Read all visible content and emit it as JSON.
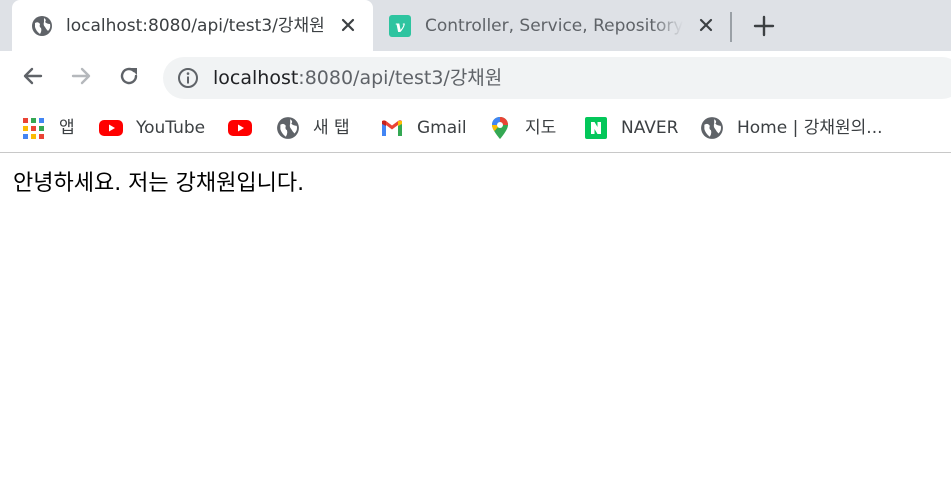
{
  "tabs": [
    {
      "title": "localhost:8080/api/test3/강채원",
      "active": true,
      "favicon": "globe-icon"
    },
    {
      "title": "Controller, Service, Repository 가",
      "active": false,
      "favicon": "vue-icon"
    }
  ],
  "toolbar": {
    "back": "back-arrow-icon",
    "forward": "forward-arrow-icon",
    "reload": "reload-icon",
    "url_host": "localhost",
    "url_path": ":8080/api/test3/강채원"
  },
  "bookmarks": [
    {
      "label": "앱",
      "icon": "apps-grid-icon"
    },
    {
      "label": "YouTube",
      "icon": "youtube-icon"
    },
    {
      "label": "",
      "icon": "youtube-icon"
    },
    {
      "label": "새 탭",
      "icon": "globe-icon"
    },
    {
      "label": "Gmail",
      "icon": "gmail-icon"
    },
    {
      "label": "지도",
      "icon": "maps-pin-icon"
    },
    {
      "label": "NAVER",
      "icon": "naver-icon"
    },
    {
      "label": "Home | 강채원의...",
      "icon": "globe-icon"
    }
  ],
  "page": {
    "text": "안녕하세요. 저는 강채원입니다."
  },
  "colors": {
    "tabstrip": "#dee1e6",
    "omnibox": "#f1f3f4",
    "youtube_red": "#ff0000",
    "naver_green": "#03c75a",
    "vue_green": "#2ec4a0"
  }
}
